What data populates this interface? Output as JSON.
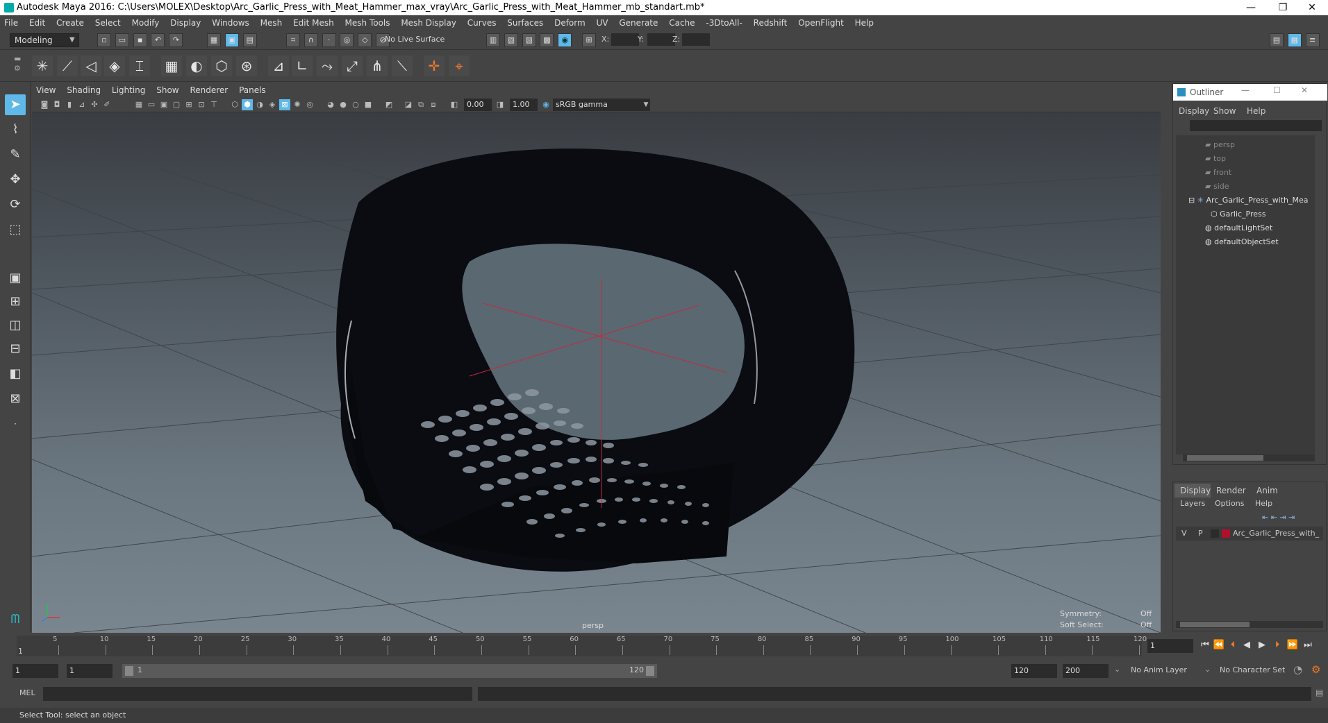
{
  "window": {
    "title": "Autodesk Maya 2016: C:\\Users\\MOLEX\\Desktop\\Arc_Garlic_Press_with_Meat_Hammer_max_vray\\Arc_Garlic_Press_with_Meat_Hammer_mb_standart.mb*",
    "minimize": "—",
    "restore": "❐",
    "close": "✕"
  },
  "menubar": [
    "File",
    "Edit",
    "Create",
    "Select",
    "Modify",
    "Display",
    "Windows",
    "Mesh",
    "Edit Mesh",
    "Mesh Tools",
    "Mesh Display",
    "Curves",
    "Surfaces",
    "Deform",
    "UV",
    "Generate",
    "Cache",
    "-3DtoAll-",
    "Redshift",
    "OpenFlight",
    "Help"
  ],
  "status": {
    "mode": "Modeling",
    "live_surface": "No Live Surface",
    "x_label": "X:",
    "y_label": "Y:",
    "z_label": "Z:"
  },
  "viewport": {
    "menu": [
      "View",
      "Shading",
      "Lighting",
      "Show",
      "Renderer",
      "Panels"
    ],
    "near": "0.00",
    "far": "1.00",
    "colorspace": "sRGB gamma",
    "camera": "persp",
    "symmetry_label": "Symmetry:",
    "symmetry_value": "Off",
    "softsel_label": "Soft Select:",
    "softsel_value": "Off"
  },
  "outliner": {
    "title": "Outliner",
    "menu": [
      "Display",
      "Show",
      "Help"
    ],
    "items": [
      "persp",
      "top",
      "front",
      "side",
      "Arc_Garlic_Press_with_Mea",
      "Garlic_Press",
      "defaultLightSet",
      "defaultObjectSet"
    ]
  },
  "layers": {
    "tabs": [
      "Display",
      "Render",
      "Anim"
    ],
    "menu": [
      "Layers",
      "Options",
      "Help"
    ],
    "row": {
      "v": "V",
      "p": "P",
      "name": "Arc_Garlic_Press_with_",
      "color": "#b0102a"
    }
  },
  "timeline": {
    "ticks": [
      "5",
      "10",
      "15",
      "20",
      "25",
      "30",
      "35",
      "40",
      "45",
      "50",
      "55",
      "60",
      "65",
      "70",
      "75",
      "80",
      "85",
      "90",
      "95",
      "100",
      "105",
      "110",
      "115",
      "120"
    ],
    "start_marker": "1",
    "current_frame": "1"
  },
  "range": {
    "start": "1",
    "anim_start": "1",
    "slider_start": "1",
    "slider_end": "120",
    "end": "120",
    "anim_end": "200",
    "anim_layer": "No Anim Layer",
    "char_set": "No Character Set"
  },
  "cmd": {
    "lang": "MEL"
  },
  "helpline": "Select Tool: select an object",
  "colors": {
    "accent": "#5fb8e8",
    "layer": "#b0102a"
  }
}
